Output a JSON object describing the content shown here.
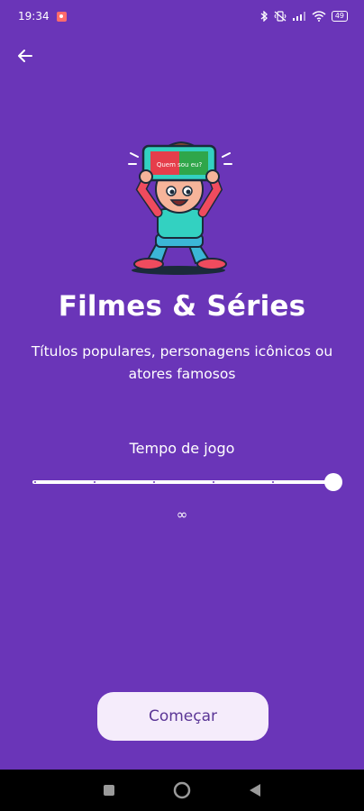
{
  "status_bar": {
    "time": "19:34",
    "battery": "49",
    "icons": [
      "recording-icon",
      "bluetooth-icon",
      "vibrate-icon",
      "signal-icon",
      "wifi-icon",
      "battery-icon"
    ]
  },
  "header": {
    "back_icon": "arrow-left-icon"
  },
  "hero": {
    "screen_text": "Quem sou eu?"
  },
  "content": {
    "title": "Filmes & Séries",
    "subtitle": "Títulos populares, personagens icônicos ou atores famosos"
  },
  "game_time": {
    "label": "Tempo de jogo",
    "value": "∞",
    "slider_level": 1.0,
    "tick_count": 6
  },
  "actions": {
    "start_label": "Começar"
  },
  "navigation": {
    "icons": [
      "square-recents-icon",
      "circle-home-icon",
      "triangle-back-icon"
    ]
  },
  "colors": {
    "background": "#6a35b8",
    "button_bg": "#f5ecfb",
    "button_text": "#5b3696"
  }
}
